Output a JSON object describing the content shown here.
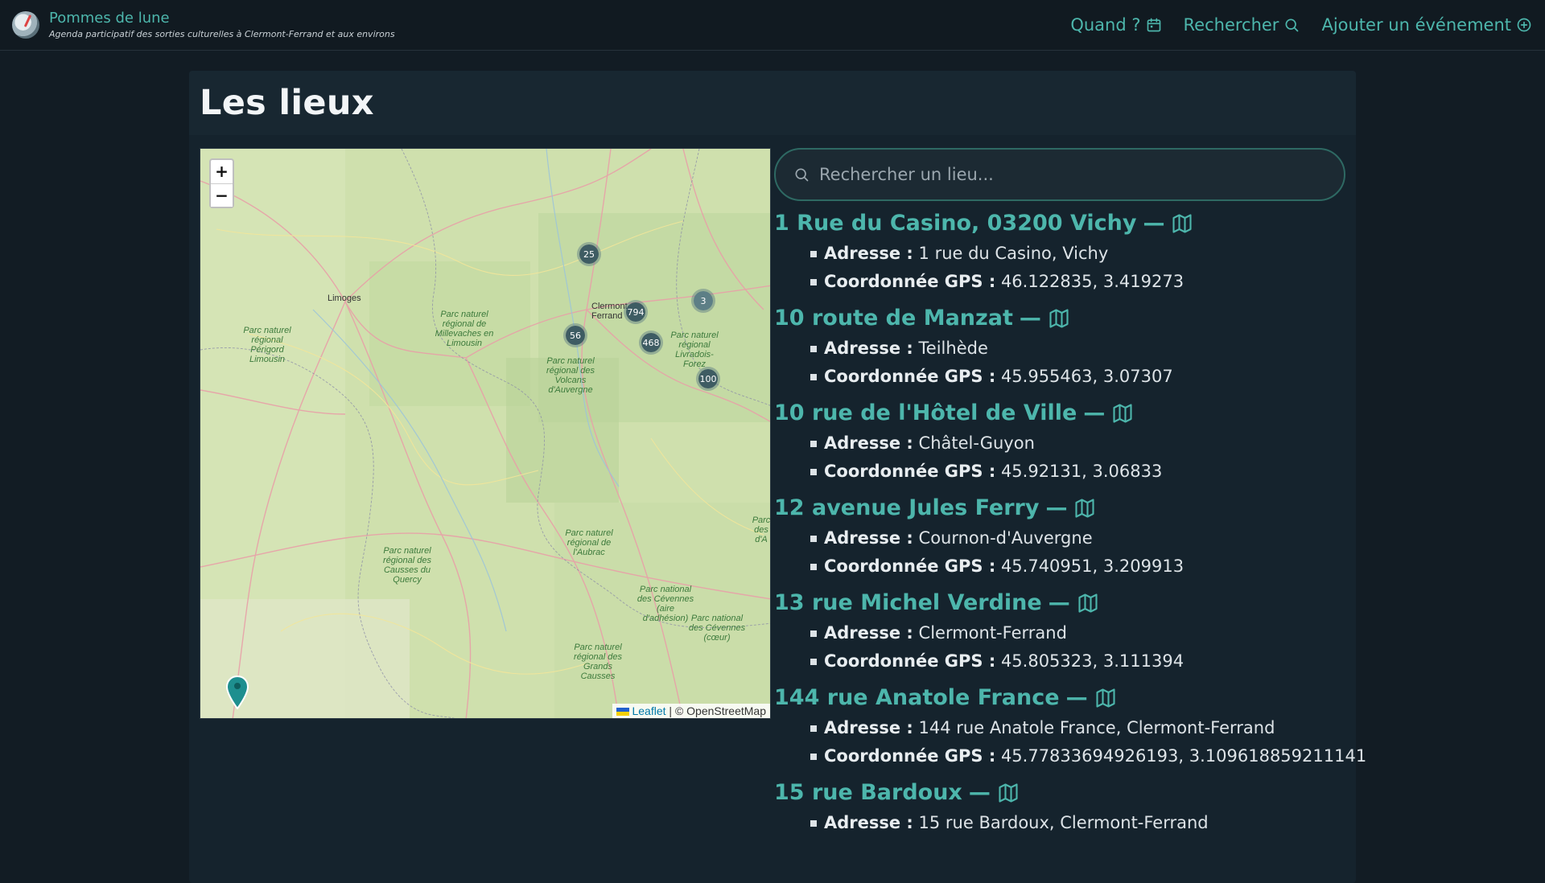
{
  "header": {
    "site_title": "Pommes de lune",
    "site_subtitle": "Agenda participatif des sorties culturelles à Clermont-Ferrand et aux environs",
    "nav": [
      {
        "label": "Quand ?",
        "icon": "calendar-icon"
      },
      {
        "label": "Rechercher",
        "icon": "search-icon"
      },
      {
        "label": "Ajouter un événement",
        "icon": "plus-circle-icon"
      }
    ]
  },
  "page": {
    "title": "Les lieux"
  },
  "map": {
    "zoom_in": "+",
    "zoom_out": "−",
    "attribution_leaflet": "Leaflet",
    "attribution_sep": "|",
    "attribution_osm": "© OpenStreetMap",
    "clusters": [
      {
        "count": "25",
        "color": "#3e5c63"
      },
      {
        "count": "794",
        "color": "#3e5c63"
      },
      {
        "count": "3",
        "color": "#5d7f86"
      },
      {
        "count": "56",
        "color": "#3e5c63"
      },
      {
        "count": "468",
        "color": "#3e5c63"
      },
      {
        "count": "100",
        "color": "#3e5c63"
      }
    ],
    "labels": {
      "limoges": "Limoges",
      "clermont": "Clermont-Ferrand",
      "parc_perigord": "Parc naturel régional Périgord Limousin",
      "parc_millevaches": "Parc naturel régional de Millevaches en Limousin",
      "parc_volcans": "Parc naturel régional des Volcans d'Auvergne",
      "parc_livradois": "Parc naturel régional Livradois-Forez",
      "parc_aubrac": "Parc naturel régional de l'Aubrac",
      "parc_causses_quercy": "Parc naturel régional des Causses du Quercy",
      "cevennes_adhesion": "Parc national des Cévennes (aire d'adhésion)",
      "cevennes_coeur": "Parc national des Cévennes (cœur)",
      "grands_causses": "Parc naturel régional des Grands Causses",
      "parc_edge": "Parc des d'A"
    }
  },
  "search": {
    "placeholder": "Rechercher un lieu..."
  },
  "places": [
    {
      "name": "1 Rue du Casino, 03200 Vichy",
      "address_label": "Adresse :",
      "address": "1 rue du Casino, Vichy",
      "gps_label": "Coordonnée GPS :",
      "gps": "46.122835, 3.419273"
    },
    {
      "name": "10 route de Manzat",
      "address_label": "Adresse :",
      "address": "Teilhède",
      "gps_label": "Coordonnée GPS :",
      "gps": "45.955463, 3.07307"
    },
    {
      "name": "10 rue de l'Hôtel de Ville",
      "address_label": "Adresse :",
      "address": "Châtel-Guyon",
      "gps_label": "Coordonnée GPS :",
      "gps": "45.92131, 3.06833"
    },
    {
      "name": "12 avenue Jules Ferry",
      "address_label": "Adresse :",
      "address": "Cournon-d'Auvergne",
      "gps_label": "Coordonnée GPS :",
      "gps": "45.740951, 3.209913"
    },
    {
      "name": "13 rue Michel Verdine",
      "address_label": "Adresse :",
      "address": "Clermont-Ferrand",
      "gps_label": "Coordonnée GPS :",
      "gps": "45.805323, 3.111394"
    },
    {
      "name": "144 rue Anatole France",
      "address_label": "Adresse :",
      "address": "144 rue Anatole France, Clermont-Ferrand",
      "gps_label": "Coordonnée GPS :",
      "gps": "45.77833694926193, 3.109618859211141"
    },
    {
      "name": "15 rue Bardoux",
      "address_label": "Adresse :",
      "address": "15 rue Bardoux, Clermont-Ferrand",
      "gps_label": "",
      "gps": ""
    }
  ],
  "colors": {
    "accent": "#4db6ac",
    "background": "#121c24",
    "panel": "#15232d"
  }
}
